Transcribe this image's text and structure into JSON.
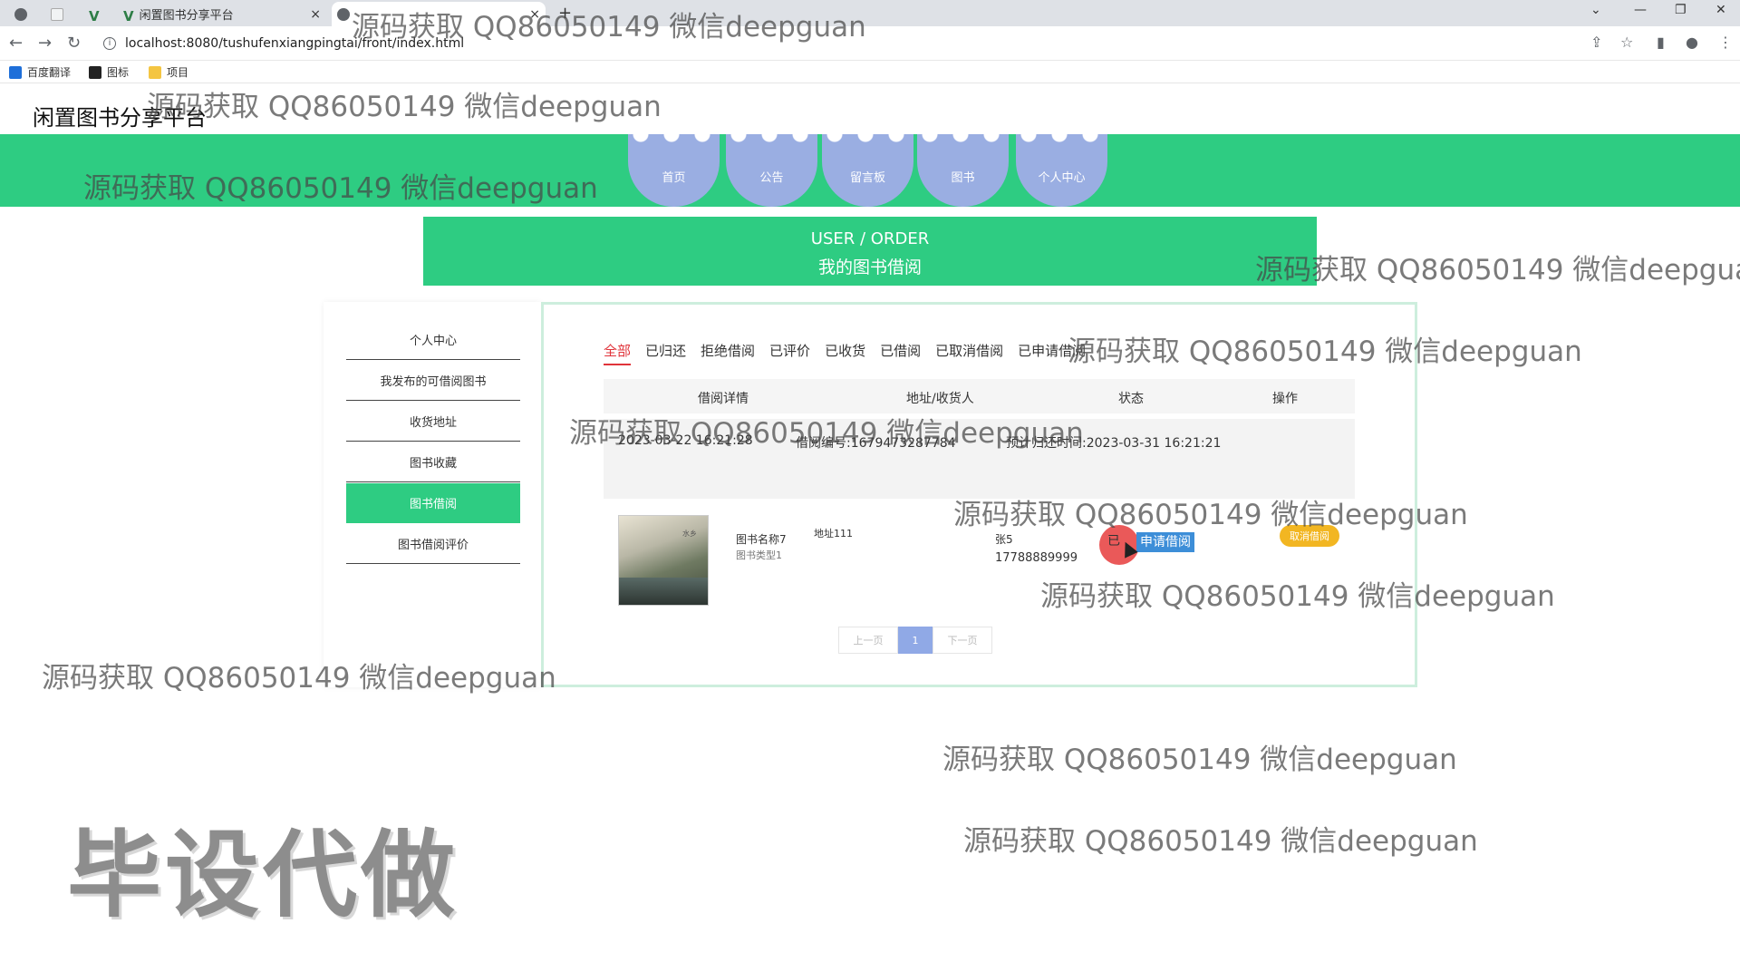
{
  "browser": {
    "tabs": [
      {
        "label": ""
      },
      {
        "label": ""
      },
      {
        "label": ""
      },
      {
        "label": "闲置图书分享平台",
        "close": "×"
      },
      {
        "label": "",
        "close": "×"
      }
    ],
    "new_tab": "+",
    "url": "localhost:8080/tushufenxiangpingtai/front/index.html",
    "bookmarks": [
      {
        "label": "百度翻译",
        "icon": "translate-icon",
        "color": "#1e6fd9"
      },
      {
        "label": "图标",
        "icon": "image-icon",
        "color": "#222222"
      },
      {
        "label": "项目",
        "icon": "folder-icon",
        "color": "#f4c542"
      }
    ]
  },
  "site": {
    "title": "闲置图书分享平台",
    "nav": [
      "首页",
      "公告",
      "留言板",
      "图书",
      "个人中心"
    ],
    "banner_en": "USER / ORDER",
    "banner_cn": "我的图书借阅"
  },
  "side_menu": [
    {
      "label": "个人中心",
      "active": false
    },
    {
      "label": "我发布的可借阅图书",
      "active": false
    },
    {
      "label": "收货地址",
      "active": false
    },
    {
      "label": "图书收藏",
      "active": false
    },
    {
      "label": "图书借阅",
      "active": true
    },
    {
      "label": "图书借阅评价",
      "active": false
    }
  ],
  "filter_tabs": [
    "全部",
    "已归还",
    "拒绝借阅",
    "已评价",
    "已收货",
    "已借阅",
    "已取消借阅",
    "已申请借阅"
  ],
  "active_tab": "全部",
  "table": {
    "headers": [
      "借阅详情",
      "地址/收货人",
      "状态",
      "操作"
    ]
  },
  "order": {
    "time": "2023-03-22 16:21:28",
    "number": "借阅编号:1679473287784",
    "due": "预计归还时间:2023-03-31 16:21:21",
    "book_name": "图书名称7",
    "book_type": "图书类型1",
    "address": "地址111",
    "receiver": "张5",
    "phone": "17788889999",
    "status_prefix": "已",
    "status_highlight": "申请借阅",
    "action": "取消借阅",
    "cover_text": "水乡"
  },
  "pager": {
    "prev": "上一页",
    "current": "1",
    "next": "下一页"
  },
  "watermark": "源码获取 QQ86050149 微信deepguan",
  "stamp": "毕设代做",
  "colors": {
    "brand_green": "#2ecc82",
    "nav_blob": "#9aaee2",
    "active_tab": "#e0333a",
    "cancel": "#f2b622",
    "pager_active": "#90a9e6"
  }
}
